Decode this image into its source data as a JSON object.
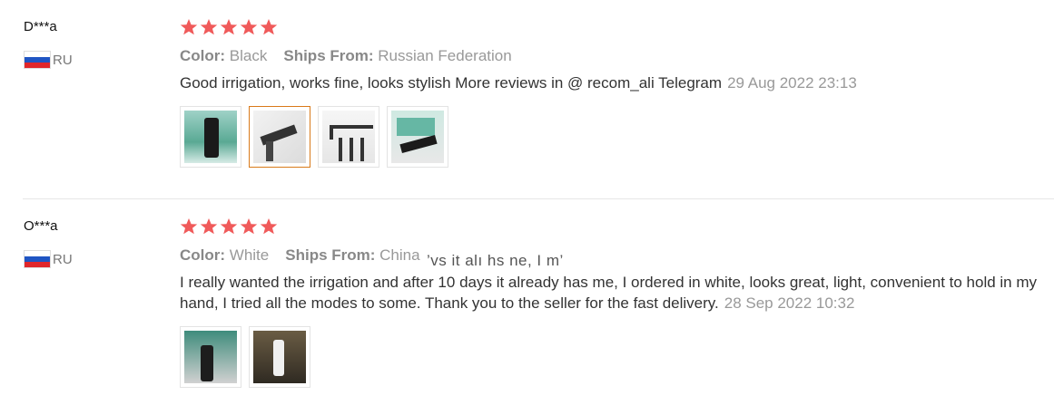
{
  "reviews": [
    {
      "user": "D***a",
      "country": "RU",
      "stars": 5,
      "color_label": "Color:",
      "color_value": "Black",
      "ships_label": "Ships From:",
      "ships_value": "Russian Federation",
      "text": "Good irrigation, works fine, looks stylish More reviews in @ recom_ali Telegram",
      "date": "29 Aug 2022 23:13",
      "images": [
        "product-photo",
        "product-photo",
        "product-photo",
        "product-photo"
      ]
    },
    {
      "user": "O***a",
      "country": "RU",
      "stars": 5,
      "color_label": "Color:",
      "color_value": "White",
      "ships_label": "Ships From:",
      "ships_value": "China",
      "overlay_text": "’vs it alı hs ne, I m’",
      "text": "I really wanted the irrigation and after 10 days it already has me, I ordered in white, looks great, light, convenient to hold in my hand, I tried all the modes to some. Thank you to the seller for the fast delivery.",
      "date": "28 Sep 2022 10:32",
      "images": [
        "product-photo",
        "product-photo"
      ]
    }
  ],
  "colors": {
    "star": "#f05a5a",
    "active_thumb_border": "#d97a1a",
    "meta_text": "#999999",
    "flag_blue": "#1f55c3",
    "flag_red": "#e0262b"
  },
  "icons": {
    "star": "star-icon",
    "flag": "russia-flag-icon"
  }
}
